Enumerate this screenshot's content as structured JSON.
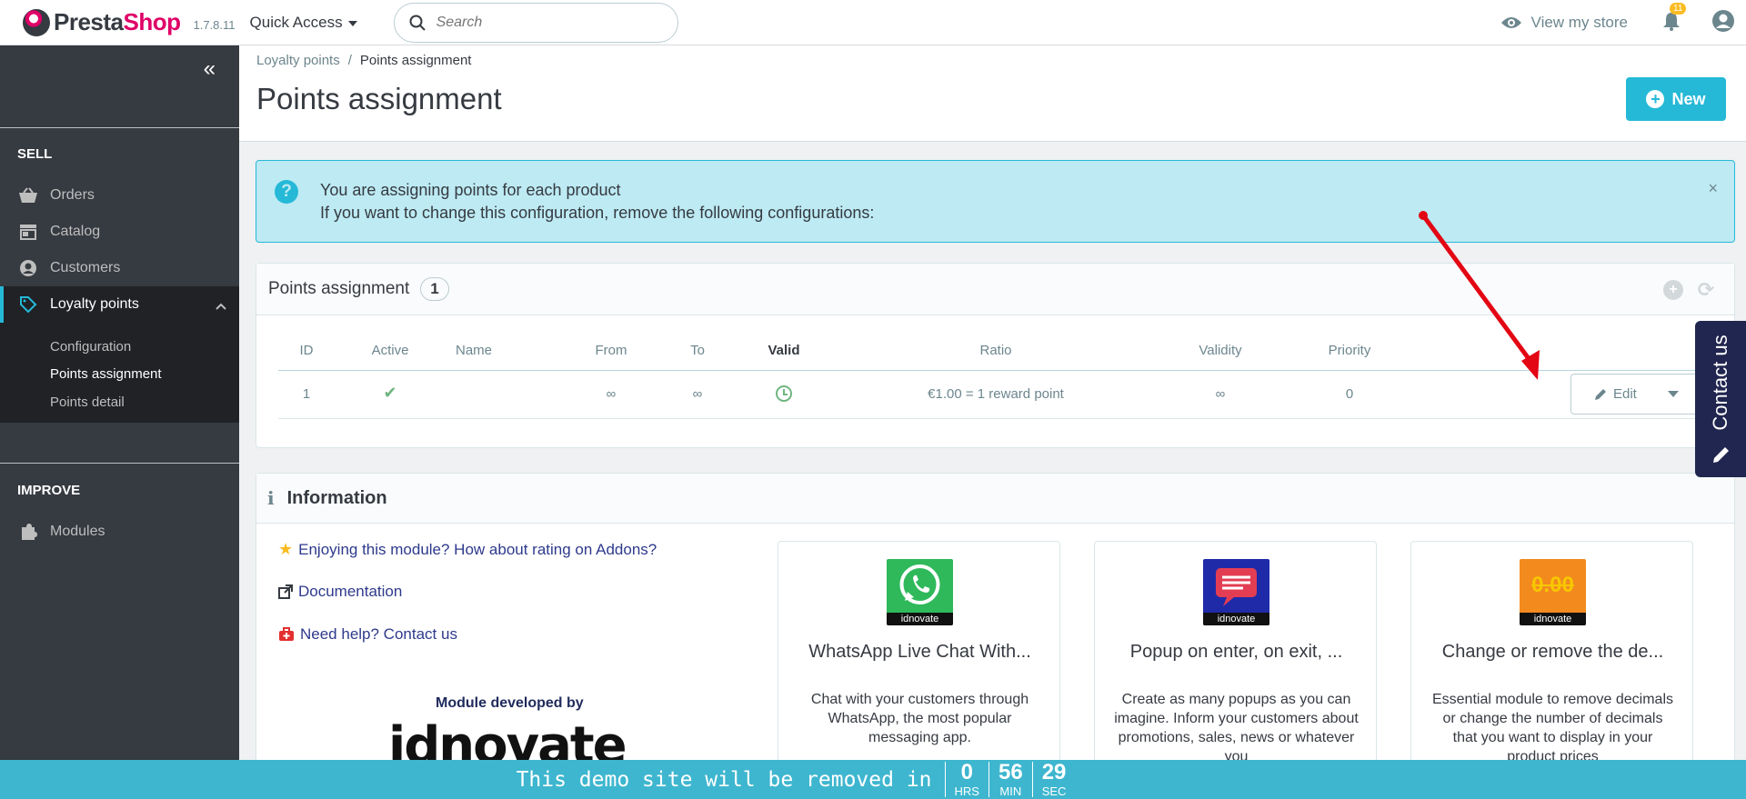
{
  "header": {
    "logo_part1": "Presta",
    "logo_part2": "Shop",
    "version": "1.7.8.11",
    "quick_access": "Quick Access",
    "search_placeholder": "Search",
    "view_store": "View my store",
    "notification_count": "11"
  },
  "sidebar": {
    "sell_title": "SELL",
    "items": [
      {
        "label": "Orders",
        "icon": "basket-icon"
      },
      {
        "label": "Catalog",
        "icon": "store-icon"
      },
      {
        "label": "Customers",
        "icon": "account-icon"
      },
      {
        "label": "Loyalty points",
        "icon": "tag-icon"
      }
    ],
    "submenu": [
      "Configuration",
      "Points assignment",
      "Points detail"
    ],
    "improve_title": "IMPROVE",
    "improve_items": [
      {
        "label": "Modules",
        "icon": "puzzle-icon"
      }
    ]
  },
  "breadcrumb": {
    "parent": "Loyalty points",
    "separator": "/",
    "current": "Points assignment"
  },
  "page": {
    "title": "Points assignment",
    "new_button": "New"
  },
  "alert": {
    "line1": "You are assigning points for each product",
    "line2": "If you want to change this configuration, remove the following configurations:"
  },
  "points_panel": {
    "title": "Points assignment",
    "count": "1",
    "columns": [
      "ID",
      "Active",
      "Name",
      "From",
      "To",
      "Valid",
      "Ratio",
      "Validity",
      "Priority"
    ],
    "rows": [
      {
        "id": "1",
        "name": "",
        "from": "∞",
        "to": "∞",
        "ratio": "€1.00 = 1 reward point",
        "validity": "∞",
        "priority": "0"
      }
    ],
    "edit_label": "Edit"
  },
  "info_panel": {
    "title": "Information",
    "links": [
      "Enjoying this module? How about rating on Addons?",
      "Documentation",
      "Need help? Contact us"
    ],
    "developed_by": "Module developed by",
    "developer_logo": "idnovate",
    "cards": [
      {
        "title": "WhatsApp Live Chat With...",
        "desc": "Chat with your customers through WhatsApp, the most popular messaging app.",
        "band": "idnovate",
        "color": "#2fb95b"
      },
      {
        "title": "Popup on enter, on exit, ...",
        "desc": "Create as many popups as you can imagine. Inform your customers about promotions, sales, news or whatever you",
        "band": "idnovate",
        "color": "#1f2aa8"
      },
      {
        "title": "Change or remove the de...",
        "desc": "Essential module to remove decimals or change the number of decimals that you want to display in your product prices",
        "band": "idnovate",
        "img_text": "0.00",
        "color": "#f28a1e"
      }
    ]
  },
  "contact_tab": {
    "label": "Contact us"
  },
  "timer": {
    "message": "This demo site will be removed in",
    "hours": "0",
    "hours_label": "HRS",
    "minutes": "56",
    "minutes_label": "MIN",
    "seconds": "29",
    "seconds_label": "SEC"
  }
}
